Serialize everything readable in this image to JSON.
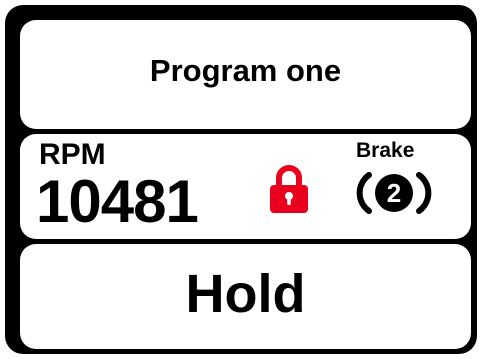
{
  "header": {
    "program_title": "Program one"
  },
  "readout": {
    "rpm_label": "RPM",
    "rpm_value": "10481",
    "brake_label": "Brake",
    "brake_level": "2",
    "lock_icon": "padlock-locked-icon",
    "brake_icon": "brake-warning-icon"
  },
  "footer": {
    "status": "Hold"
  },
  "colors": {
    "frame": "#000000",
    "panel": "#ffffff",
    "lock": "#e8001c",
    "text": "#000000"
  }
}
